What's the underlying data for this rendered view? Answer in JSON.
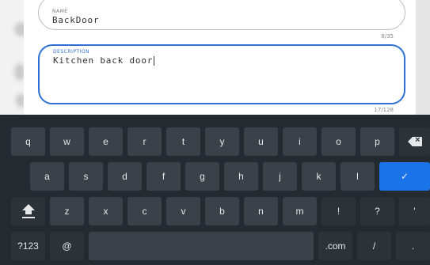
{
  "form": {
    "name": {
      "label": "NAME",
      "value": "BackDoor",
      "counter": "8/35"
    },
    "description": {
      "label": "DESCRIPTION",
      "value": "Kitchen back door",
      "counter": "17/128"
    }
  },
  "keyboard": {
    "row1": [
      "q",
      "w",
      "e",
      "r",
      "t",
      "y",
      "u",
      "i",
      "o",
      "p"
    ],
    "row2": [
      "a",
      "s",
      "d",
      "f",
      "g",
      "h",
      "j",
      "k",
      "l"
    ],
    "row3": [
      "z",
      "x",
      "c",
      "v",
      "b",
      "n",
      "m",
      "!",
      "?",
      "'"
    ],
    "row4": {
      "symbols": "?123",
      "at": "@",
      "dotcom": ".com",
      "slash": "/",
      "period": "."
    },
    "enter_label": "✓",
    "colors": {
      "background": "#232a30",
      "key": "#3a4148",
      "accent": "#1a73e8"
    }
  }
}
